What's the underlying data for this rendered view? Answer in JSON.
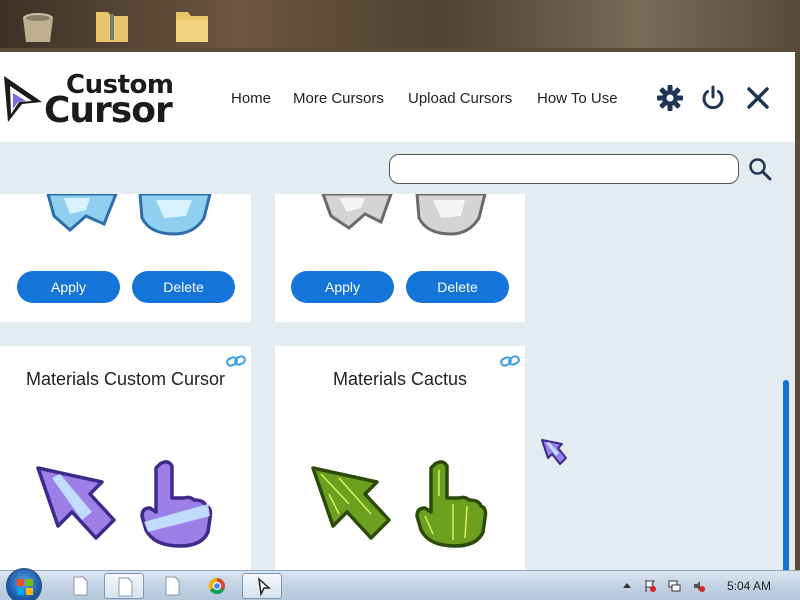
{
  "header": {
    "logo_line1": "Custom",
    "logo_line2": "Cursor",
    "nav": [
      "Home",
      "More Cursors",
      "Upload Cursors",
      "How To Use"
    ]
  },
  "search": {
    "value": "",
    "placeholder": ""
  },
  "cards": [
    {
      "title": "",
      "apply_label": "Apply",
      "delete_label": "Delete"
    },
    {
      "title": "",
      "apply_label": "Apply",
      "delete_label": "Delete"
    },
    {
      "title": "Materials Custom Cursor"
    },
    {
      "title": "Materials Cactus"
    }
  ],
  "taskbar": {
    "time": "5:04 AM"
  },
  "colors": {
    "accent": "#1474d8",
    "background": "#e3ecf1"
  },
  "icons": [
    "gear-icon",
    "power-icon",
    "close-icon",
    "search-icon",
    "link-icon"
  ]
}
